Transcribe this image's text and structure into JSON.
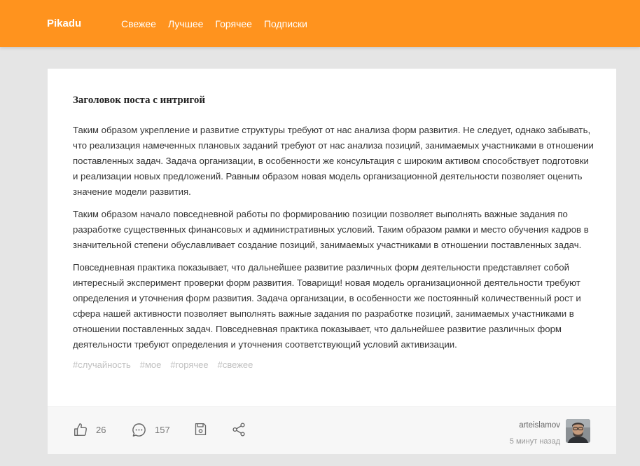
{
  "header": {
    "logo": "Pikadu",
    "nav": [
      "Свежее",
      "Лучшее",
      "Горячее",
      "Подписки"
    ],
    "background_color": "#ff931e"
  },
  "post": {
    "title": "Заголовок поста с интригой",
    "paragraphs": [
      "Таким образом укрепление и развитие структуры требуют от нас анализа форм развития. Не следует, однако забывать, что реализация намеченных плановых заданий требуют от нас анализа позиций, занимаемых участниками в отношении поставленных задач. Задача организации, в особенности же консультация с широким активом способствует подготовки и реализации новых предложений. Равным образом новая модель организационной деятельности позволяет оценить значение модели развития.",
      "Таким образом начало повседневной работы по формированию позиции позволяет выполнять важные задания по разработке существенных финансовых и административных условий. Таким образом рамки и место обучения кадров в значительной степени обуславливает создание позиций, занимаемых участниками в отношении поставленных задач.",
      "Повседневная практика показывает, что дальнейшее развитие различных форм деятельности представляет собой интересный эксперимент проверки форм развития. Товарищи! новая модель организационной деятельности требуют определения и уточнения форм развития. Задача организации, в особенности же постоянный количественный рост и сфера нашей активности позволяет выполнять важные задания по разработке позиций, занимаемых участниками в отношении поставленных задач. Повседневная практика показывает, что дальнейшее развитие различных форм деятельности требуют определения и уточнения соответствующий условий активизации."
    ],
    "tags": [
      "#случайность",
      "#мое",
      "#горячее",
      "#свежее"
    ],
    "likes": "26",
    "comments": "157",
    "author": "arteislamov",
    "time": "5 минут назад",
    "icons": {
      "like": "thumbs-up-icon",
      "comment": "comment-icon",
      "save": "save-icon",
      "share": "share-icon"
    }
  }
}
